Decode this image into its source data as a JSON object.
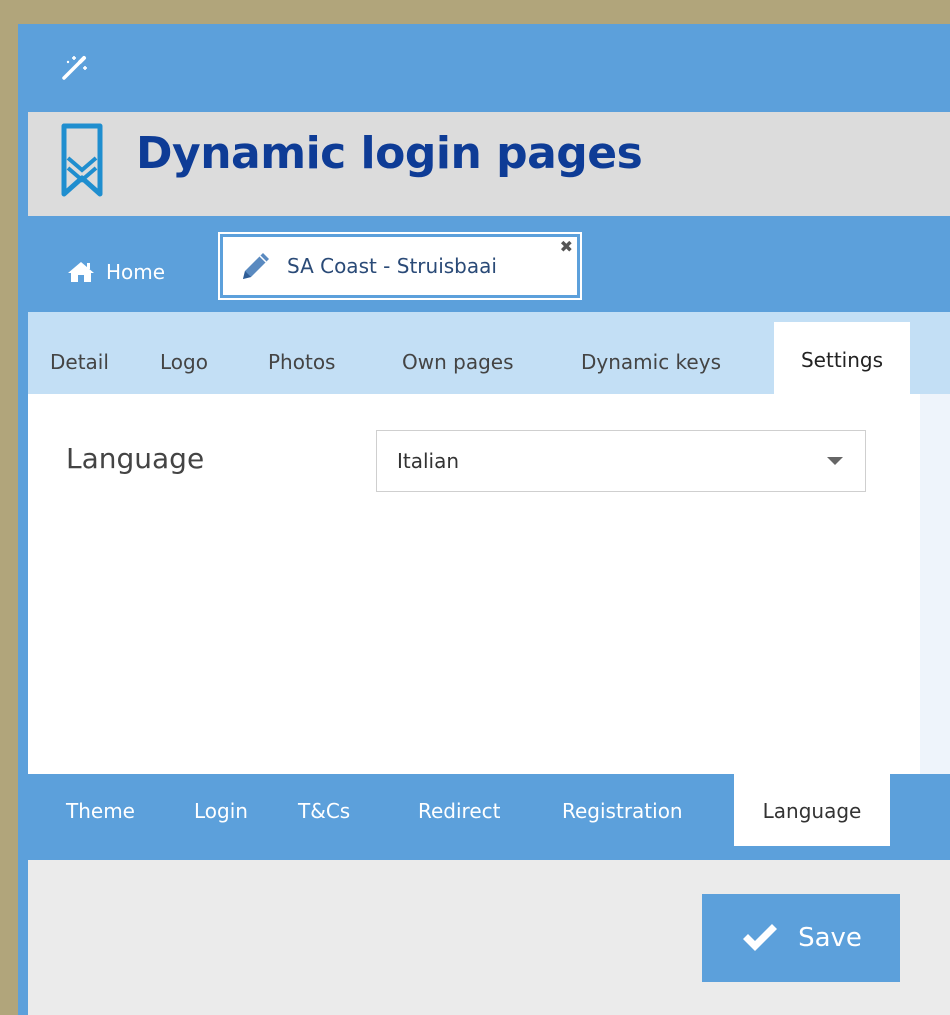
{
  "app": {
    "title": "Dynamic login pages"
  },
  "nav": {
    "home_label": "Home",
    "doc_tab_label": "SA Coast - Struisbaai",
    "close_glyph": "✖"
  },
  "tabs": [
    {
      "label": "Detail"
    },
    {
      "label": "Logo"
    },
    {
      "label": "Photos"
    },
    {
      "label": "Own pages"
    },
    {
      "label": "Dynamic keys"
    },
    {
      "label": "Settings",
      "active": true
    }
  ],
  "settings": {
    "language_label": "Language",
    "language_value": "Italian"
  },
  "subtabs": [
    {
      "label": "Theme"
    },
    {
      "label": "Login"
    },
    {
      "label": "T&Cs"
    },
    {
      "label": "Redirect"
    },
    {
      "label": "Registration"
    },
    {
      "label": "Language",
      "active": true
    }
  ],
  "footer": {
    "save_label": "Save"
  },
  "colors": {
    "primary": "#5ca0db",
    "title": "#0e3c96",
    "tabstrip": "#c3dff5",
    "frame": "#b1a57b"
  },
  "icons": {
    "wand": "magic-wand-icon",
    "logo": "bookmark-logo-icon",
    "home": "home-icon",
    "pencil": "pencil-icon",
    "close": "close-icon",
    "caret": "caret-down-icon",
    "check": "checkmark-icon"
  }
}
